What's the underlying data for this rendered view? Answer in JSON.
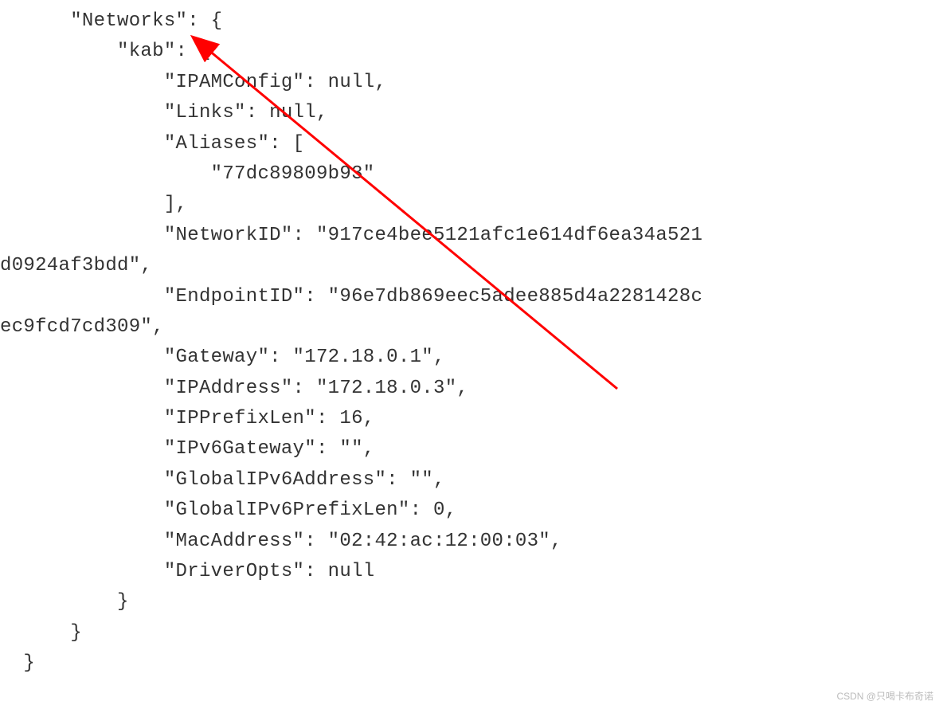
{
  "code": {
    "line1": "      \"Networks\": {",
    "line2": "          \"kab\": {",
    "line3": "              \"IPAMConfig\": null,",
    "line4": "              \"Links\": null,",
    "line5": "              \"Aliases\": [",
    "line6": "                  \"77dc89809b93\"",
    "line7": "              ],",
    "line8": "              \"NetworkID\": \"917ce4bee5121afc1e614df6ea34a521",
    "line9": "d0924af3bdd\",",
    "line10": "              \"EndpointID\": \"96e7db869eec5adee885d4a2281428c",
    "line11": "ec9fcd7cd309\",",
    "line12": "              \"Gateway\": \"172.18.0.1\",",
    "line13": "              \"IPAddress\": \"172.18.0.3\",",
    "line14": "              \"IPPrefixLen\": 16,",
    "line15": "              \"IPv6Gateway\": \"\",",
    "line16": "              \"GlobalIPv6Address\": \"\",",
    "line17": "              \"GlobalIPv6PrefixLen\": 0,",
    "line18": "              \"MacAddress\": \"02:42:ac:12:00:03\",",
    "line19": "              \"DriverOpts\": null",
    "line20": "          }",
    "line21": "      }",
    "line22": "  }"
  },
  "watermark": "CSDN @只喝卡布奇诺"
}
